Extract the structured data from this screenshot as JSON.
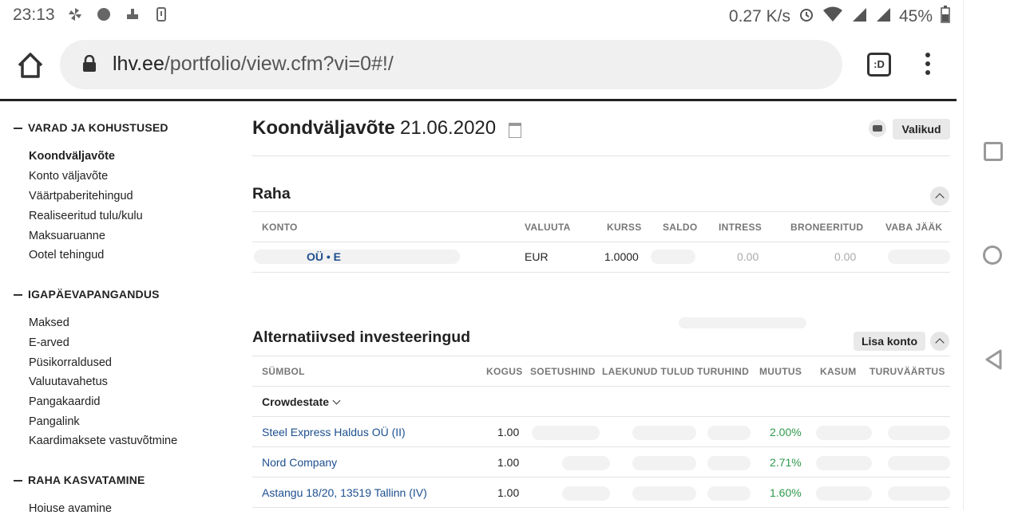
{
  "status": {
    "time": "23:13",
    "speed": "0.27 K/s",
    "battery": "45%"
  },
  "browser": {
    "url_domain": "lhv.ee",
    "url_path": "/portfolio/view.cfm?vi=0#!/",
    "tabs_label": ":D"
  },
  "sidebar": {
    "sections": [
      {
        "title": "VARAD JA KOHUSTUSED",
        "items": [
          "Koondväljavõte",
          "Konto väljavõte",
          "Väärtpaberitehingud",
          "Realiseeritud tulu/kulu",
          "Maksuaruanne",
          "Ootel tehingud"
        ]
      },
      {
        "title": "IGAPÄEVAPANGANDUS",
        "items": [
          "Maksed",
          "E-arved",
          "Püsikorraldused",
          "Valuutavahetus",
          "Pangakaardid",
          "Pangalink",
          "Kaardimaksete vastuvõtmine"
        ]
      },
      {
        "title": "RAHA KASVATAMINE",
        "items": [
          "Hoiuse avamine"
        ]
      }
    ]
  },
  "main": {
    "title": "Koondväljavõte",
    "date": "21.06.2020",
    "valikud": "Valikud",
    "raha": {
      "title": "Raha",
      "headers": [
        "KONTO",
        "VALUUTA",
        "KURSS",
        "SALDO",
        "INTRESS",
        "BRONEERITUD",
        "VABA JÄÄK"
      ],
      "row": {
        "konto": "OÜ • E",
        "valuuta": "EUR",
        "kurss": "1.0000",
        "intress": "0.00",
        "broneeritud": "0.00"
      }
    },
    "alt": {
      "title": "Alternatiivsed investeeringud",
      "lisa": "Lisa konto",
      "headers": [
        "SÜMBOL",
        "KOGUS",
        "SOETUSHIND",
        "LAEKUNUD TULUD",
        "TURUHIND",
        "MUUTUS",
        "KASUM",
        "TURUVÄÄRTUS"
      ],
      "group": "Crowdestate",
      "rows": [
        {
          "name": "Steel Express Haldus OÜ (II)",
          "kogus": "1.00",
          "muutus": "2.00%"
        },
        {
          "name": "Nord Company",
          "kogus": "1.00",
          "muutus": "2.71%"
        },
        {
          "name": "Astangu 18/20, 13519 Tallinn (IV)",
          "kogus": "1.00",
          "muutus": "1.60%"
        }
      ]
    }
  }
}
